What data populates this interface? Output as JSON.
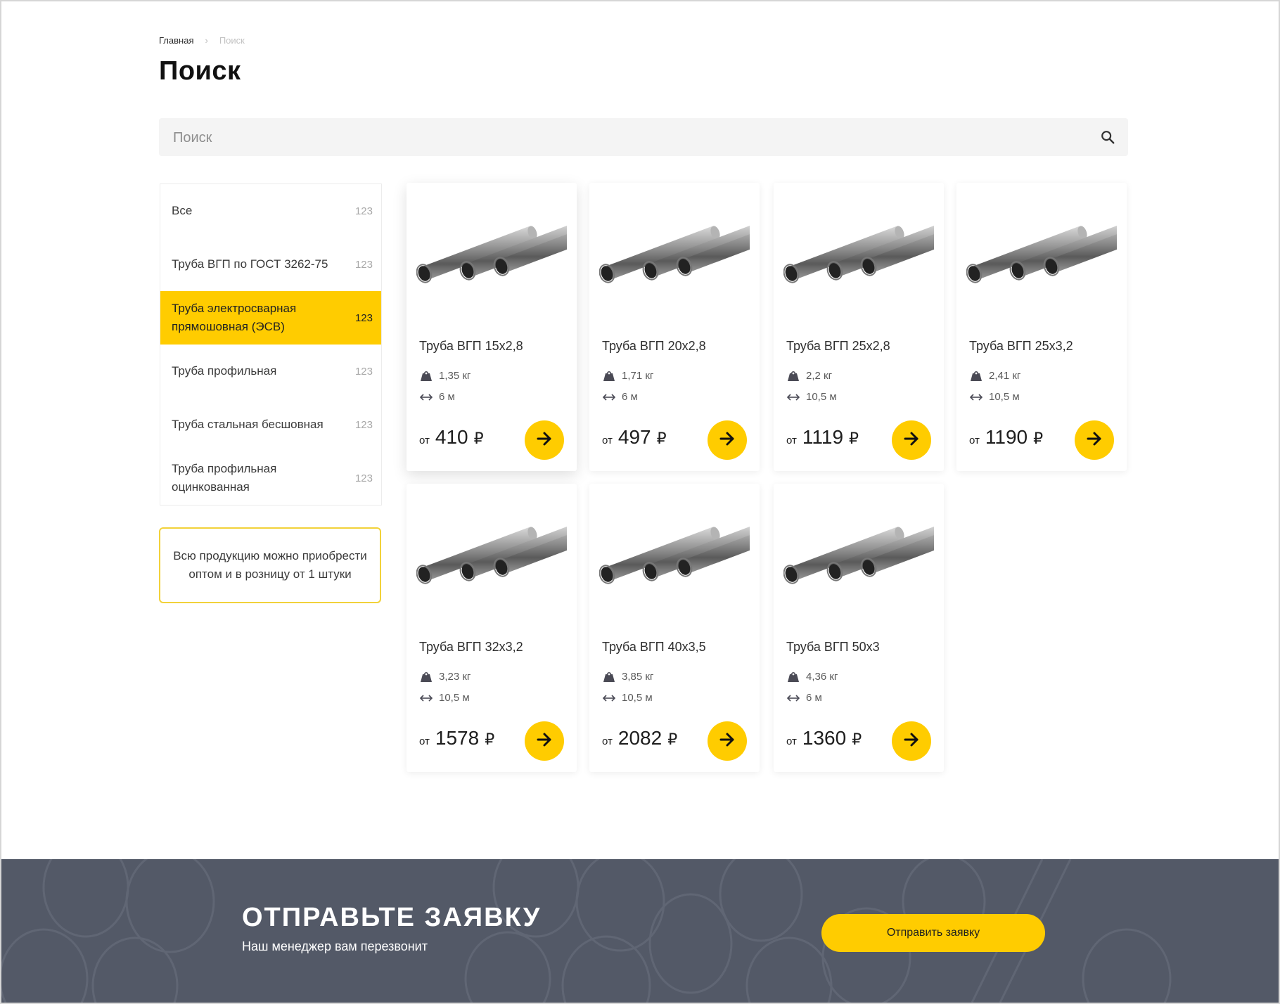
{
  "breadcrumb": {
    "home": "Главная",
    "current": "Поиск"
  },
  "page_title": "Поиск",
  "search": {
    "placeholder": "Поиск",
    "value": ""
  },
  "categories": [
    {
      "label": "Все",
      "count": "123",
      "active": false
    },
    {
      "label": "Труба ВГП по ГОСТ 3262-75",
      "count": "123",
      "active": false
    },
    {
      "label": "Труба электросварная прямошовная (ЭСВ)",
      "count": "123",
      "active": true
    },
    {
      "label": "Труба профильная",
      "count": "123",
      "active": false
    },
    {
      "label": "Труба стальная бесшовная",
      "count": "123",
      "active": false
    },
    {
      "label": "Труба профильная оцинкованная",
      "count": "123",
      "active": false
    }
  ],
  "notice": "Всю продукцию можно приобрести оптом и в розницу от 1 штуки",
  "price_prefix": "от",
  "currency": "₽",
  "products": [
    {
      "name": "Труба ВГП 15х2,8",
      "weight": "1,35 кг",
      "length": "6 м",
      "price": "410"
    },
    {
      "name": "Труба ВГП 20х2,8",
      "weight": "1,71 кг",
      "length": "6 м",
      "price": "497"
    },
    {
      "name": "Труба ВГП 25х2,8",
      "weight": "2,2 кг",
      "length": "10,5 м",
      "price": "1119"
    },
    {
      "name": "Труба ВГП 25х3,2",
      "weight": "2,41 кг",
      "length": "10,5 м",
      "price": "1190"
    },
    {
      "name": "Труба ВГП 32х3,2",
      "weight": "3,23 кг",
      "length": "10,5 м",
      "price": "1578"
    },
    {
      "name": "Труба ВГП 40х3,5",
      "weight": "3,85 кг",
      "length": "10,5 м",
      "price": "2082"
    },
    {
      "name": "Труба ВГП 50х3",
      "weight": "4,36 кг",
      "length": "6 м",
      "price": "1360"
    }
  ],
  "footer": {
    "title": "ОТПРАВЬТЕ ЗАЯВКУ",
    "subtitle": "Наш менеджер вам перезвонит",
    "button": "Отправить заявку"
  },
  "colors": {
    "accent": "#ffcc00",
    "footer_bg": "#535967"
  }
}
